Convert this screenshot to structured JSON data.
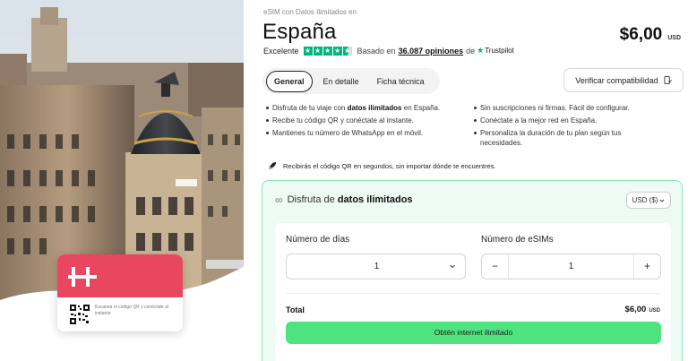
{
  "breadcrumb": "eSIM con Datos Ilimitados en",
  "title": "España",
  "price": {
    "amount": "$6,00",
    "currency": "USD"
  },
  "rating": {
    "label": "Excelente",
    "stars": 4.5,
    "based_on": "Basado en",
    "reviews": "36.087 opiniones",
    "de": "de",
    "provider": "Trustpilot"
  },
  "tabs": [
    {
      "label": "General",
      "active": true
    },
    {
      "label": "En detalle",
      "active": false
    },
    {
      "label": "Ficha técnica",
      "active": false
    }
  ],
  "verify_button": "Verificar compatibilidad",
  "features_left": [
    {
      "pre": "Disfruta de tu viaje con ",
      "bold": "datos ilimitados",
      "post": " en España."
    },
    {
      "pre": "Recibe tu código QR y conéctate al instante.",
      "bold": "",
      "post": ""
    },
    {
      "pre": "Mantienes tu número de WhatsApp en el móvil.",
      "bold": "",
      "post": ""
    }
  ],
  "features_right": [
    {
      "text": "Sin suscripciones ni firmas. Fácil de configurar."
    },
    {
      "text": "Conéctate a la mejor red en España."
    },
    {
      "text": "Personaliza la duración de tu plan según tus necesidades."
    }
  ],
  "qr_note": "Recibirás el código QR en segundos, sin importar dónde te encuentres.",
  "plan": {
    "infinity": "∞",
    "heading_pre": "Disfruta de ",
    "heading_bold": "datos ilimitados",
    "currency_select": "USD ($)",
    "days_label": "Número de días",
    "days_value": "1",
    "esims_label": "Número de eSIMs",
    "esims_value": "1",
    "minus": "−",
    "plus": "+",
    "total_label": "Total",
    "total_amount": "$6,00",
    "total_currency": "USD",
    "cta": "Obtén internet ilimitado"
  },
  "card": {
    "text": "Escanea el código QR y conéctate al instante"
  },
  "colors": {
    "brand_red": "#e8475f",
    "cta_green": "#4fe37f",
    "trustpilot_green": "#00b67a",
    "plan_bg": "#eefaf4",
    "plan_border": "#8ee6b4"
  }
}
